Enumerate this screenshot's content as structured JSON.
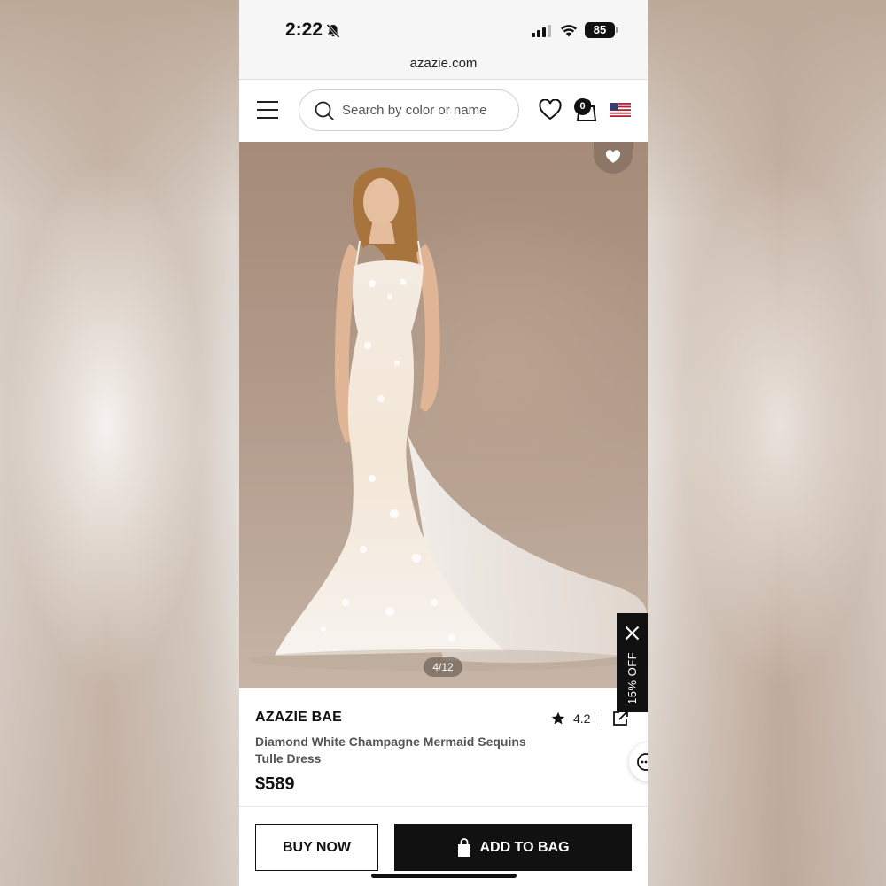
{
  "status_bar": {
    "time": "2:22",
    "battery": "85",
    "icons": [
      "bell-slash-icon",
      "signal-icon",
      "wifi-icon",
      "battery-icon"
    ]
  },
  "browser": {
    "url": "azazie.com"
  },
  "header": {
    "search_placeholder": "Search by color or name",
    "bag_count": "0",
    "icons": [
      "menu-icon",
      "search-icon",
      "heart-icon",
      "bag-icon",
      "us-flag-icon"
    ]
  },
  "gallery": {
    "counter": "4/12",
    "current_index": 4,
    "total": 12
  },
  "promo_tab": {
    "label": "15% OFF"
  },
  "product": {
    "brand": "AZAZIE BAE",
    "name": "Diamond White Champagne Mermaid Sequins Tulle Dress",
    "price": "$589",
    "rating": "4.2"
  },
  "actions": {
    "buy_now": "BUY NOW",
    "add_to_bag": "ADD TO BAG"
  },
  "colors": {
    "primary": "#111111",
    "background": "#ffffff",
    "muted_text": "#555555"
  }
}
